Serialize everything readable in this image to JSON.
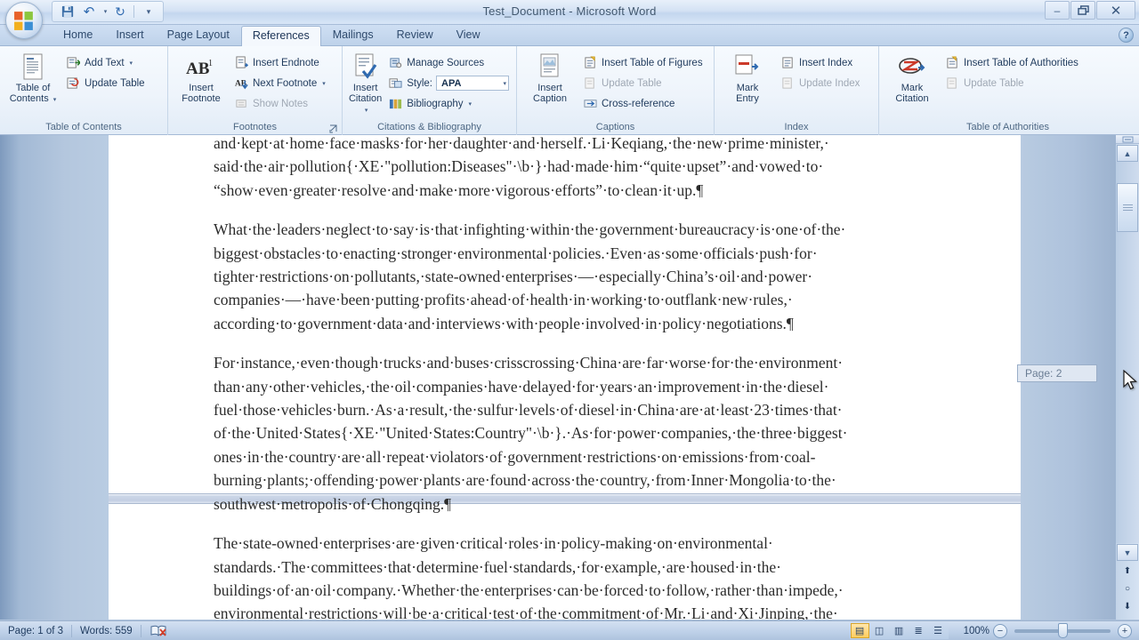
{
  "window": {
    "title": "Test_Document - Microsoft Word",
    "minimize": "–",
    "restore": "❐",
    "close": "✕"
  },
  "quick_access": {
    "save": "💾",
    "undo": "↶",
    "undo_caret": "▾",
    "redo": "↻",
    "customize": "▾"
  },
  "help": {
    "label": "?"
  },
  "tabs": [
    {
      "label": "Home",
      "active": false
    },
    {
      "label": "Insert",
      "active": false
    },
    {
      "label": "Page Layout",
      "active": false
    },
    {
      "label": "References",
      "active": true
    },
    {
      "label": "Mailings",
      "active": false
    },
    {
      "label": "Review",
      "active": false
    },
    {
      "label": "View",
      "active": false
    }
  ],
  "ribbon": {
    "groups": [
      {
        "name": "table-of-contents",
        "label": "Table of Contents",
        "big": {
          "label_line1": "Table of",
          "label_line2": "Contents",
          "caret": "▾"
        },
        "items": [
          {
            "label": "Add Text",
            "caret": "▾",
            "dim": false
          },
          {
            "label": "Update Table",
            "caret": "",
            "dim": false
          }
        ],
        "launcher": ""
      },
      {
        "name": "footnotes",
        "label": "Footnotes",
        "big": {
          "label_line1": "Insert",
          "label_line2": "Footnote",
          "caret": ""
        },
        "items": [
          {
            "label": "Insert Endnote",
            "caret": "",
            "dim": false
          },
          {
            "label": "Next Footnote",
            "caret": "▾",
            "dim": false
          },
          {
            "label": "Show Notes",
            "caret": "",
            "dim": true
          }
        ],
        "launcher": "⤡"
      },
      {
        "name": "citations-bibliography",
        "label": "Citations & Bibliography",
        "big": {
          "label_line1": "Insert",
          "label_line2": "Citation",
          "caret": "▾"
        },
        "items": [
          {
            "label": "Manage Sources",
            "caret": "",
            "dim": false
          },
          {
            "label": "Style:",
            "caret": "",
            "dim": false
          },
          {
            "label": "Bibliography",
            "caret": "▾",
            "dim": false
          }
        ],
        "style_value": "APA",
        "style_caret": "▾",
        "launcher": ""
      },
      {
        "name": "captions",
        "label": "Captions",
        "big": {
          "label_line1": "Insert",
          "label_line2": "Caption",
          "caret": ""
        },
        "items": [
          {
            "label": "Insert Table of Figures",
            "caret": "",
            "dim": false
          },
          {
            "label": "Update Table",
            "caret": "",
            "dim": true
          },
          {
            "label": "Cross-reference",
            "caret": "",
            "dim": false
          }
        ],
        "launcher": ""
      },
      {
        "name": "index",
        "label": "Index",
        "big": {
          "label_line1": "Mark",
          "label_line2": "Entry",
          "caret": ""
        },
        "items": [
          {
            "label": "Insert Index",
            "caret": "",
            "dim": false
          },
          {
            "label": "Update Index",
            "caret": "",
            "dim": true
          }
        ],
        "launcher": ""
      },
      {
        "name": "table-of-authorities",
        "label": "Table of Authorities",
        "big": {
          "label_line1": "Mark",
          "label_line2": "Citation",
          "caret": ""
        },
        "items": [
          {
            "label": "Insert Table of Authorities",
            "caret": "",
            "dim": false
          },
          {
            "label": "Update Table",
            "caret": "",
            "dim": true
          }
        ],
        "launcher": ""
      }
    ]
  },
  "document": {
    "paragraphs": [
      {
        "id": "para-1",
        "lines": [
          "and·kept·at·home·face·masks·for·her·daughter·and·herself.·Li·Keqiang,·the·new·prime·minister,·",
          "said·the·air·pollution{·XE·\"pollution:Diseases\"·\\b·}·had·made·him·“quite·upset”·and·vowed·to·",
          "“show·even·greater·resolve·and·make·more·vigorous·efforts”·to·clean·it·up.¶"
        ]
      },
      {
        "id": "para-2",
        "lines": [
          "What·the·leaders·neglect·to·say·is·that·infighting·within·the·government·bureaucracy·is·one·of·the·",
          "biggest·obstacles·to·enacting·stronger·environmental·policies.·Even·as·some·officials·push·for·",
          "tighter·restrictions·on·pollutants,·state-owned·enterprises·—·especially·China’s·oil·and·power·",
          "companies·—·have·been·putting·profits·ahead·of·health·in·working·to·outflank·new·rules,·",
          "according·to·government·data·and·interviews·with·people·involved·in·policy·negotiations.¶"
        ]
      },
      {
        "id": "para-3",
        "lines": [
          "For·instance,·even·though·trucks·and·buses·crisscrossing·China·are·far·worse·for·the·environment·",
          "than·any·other·vehicles,·the·oil·companies·have·delayed·for·years·an·improvement·in·the·diesel·",
          "fuel·those·vehicles·burn.·As·a·result,·the·sulfur·levels·of·diesel·in·China·are·at·least·23·times·that·",
          "of·the·United·States{·XE·\"United·States:Country\"·\\b·}.·As·for·power·companies,·the·three·biggest·",
          "ones·in·the·country·are·all·repeat·violators·of·government·restrictions·on·emissions·from·coal-",
          "burning·plants;·offending·power·plants·are·found·across·the·country,·from·Inner·Mongolia·to·the·",
          "southwest·metropolis·of·Chongqing.¶"
        ]
      },
      {
        "id": "para-4",
        "lines": [
          "The·state-owned·enterprises·are·given·critical·roles·in·policy-making·on·environmental·",
          "standards.·The·committees·that·determine·fuel·standards,·for·example,·are·housed·in·the·",
          "buildings·of·an·oil·company.·Whether·the·enterprises·can·be·forced·to·follow,·rather·than·impede,·",
          "environmental·restrictions·will·be·a·critical·test·of·the·commitment·of·Mr.·Li·and·Xi·Jinping,·the·"
        ]
      }
    ]
  },
  "scroll_tooltip": {
    "label": "Page: 2"
  },
  "scrollbar": {
    "split_handle": "≡",
    "up_arrow": "▲",
    "down_arrow": "▼",
    "prev_page": "⬆",
    "select_object": "○",
    "next_page": "⬇"
  },
  "status_bar": {
    "page": "Page: 1 of 3",
    "words": "Words: 559",
    "proofing_icon": "proofing-errors-icon",
    "views": [
      {
        "name": "print-layout",
        "glyph": "▤",
        "selected": true
      },
      {
        "name": "full-screen-reading",
        "glyph": "◫",
        "selected": false
      },
      {
        "name": "web-layout",
        "glyph": "▥",
        "selected": false
      },
      {
        "name": "outline",
        "glyph": "≣",
        "selected": false
      },
      {
        "name": "draft",
        "glyph": "☰",
        "selected": false
      }
    ],
    "zoom_level": "100%",
    "zoom_out": "−",
    "zoom_in": "+"
  },
  "colors": {
    "accent": "#2e4a6d",
    "ribbon_bg": "#eef4fb",
    "page_bg": "#ffffff",
    "chrome_blue": "#b8cbe1",
    "selected_view": "#ffcd5e"
  }
}
